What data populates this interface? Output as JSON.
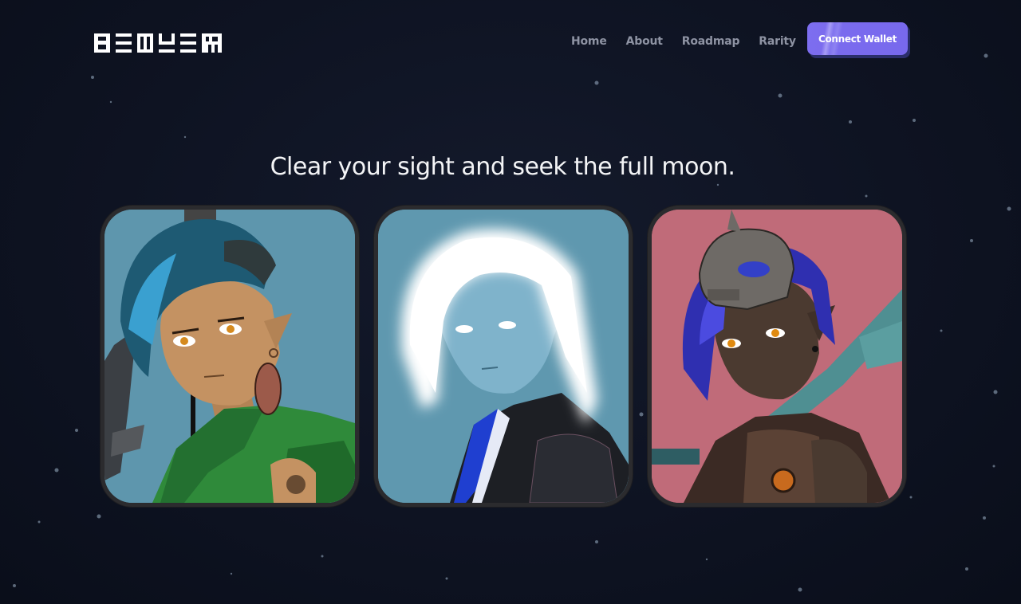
{
  "brand": {
    "logo_text": "BEMYEM",
    "logo_icon": "pixel-logo-icon"
  },
  "nav": {
    "items": [
      {
        "label": "Home"
      },
      {
        "label": "About"
      },
      {
        "label": "Roadmap"
      },
      {
        "label": "Rarity"
      }
    ],
    "connect_label": "Connect Wallet"
  },
  "hero": {
    "headline": "Clear your sight and seek the full moon."
  },
  "gallery": [
    {
      "icon": "green-hooded-elf-portrait",
      "background": "#5e96ad"
    },
    {
      "icon": "glowing-white-hair-elf-portrait",
      "background": "#5f98af"
    },
    {
      "icon": "skull-mask-elf-portrait",
      "background": "#c06b79"
    }
  ],
  "colors": {
    "accent": "#7869ed",
    "text": "#f3f4f6",
    "nav": "#8e93a3",
    "bg": "#0e1322"
  }
}
